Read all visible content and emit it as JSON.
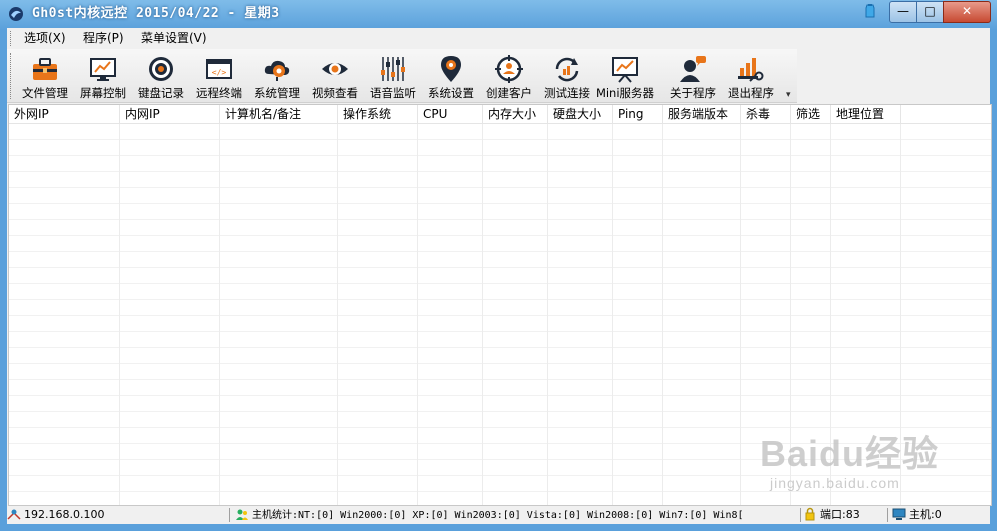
{
  "window": {
    "title": "Gh0st内核远控    2015/04/22 - 星期3",
    "buttons": {
      "minimize": "—",
      "maximize": "□",
      "close": "✕"
    }
  },
  "menubar": {
    "items": [
      {
        "label": "选项(X)"
      },
      {
        "label": "程序(P)"
      },
      {
        "label": "菜单设置(V)"
      }
    ]
  },
  "toolbar": {
    "items": [
      {
        "label": "文件管理",
        "icon": "toolbox-icon"
      },
      {
        "label": "屏幕控制",
        "icon": "monitor-chart-icon"
      },
      {
        "label": "键盘记录",
        "icon": "target-icon"
      },
      {
        "label": "远程终端",
        "icon": "code-window-icon"
      },
      {
        "label": "系统管理",
        "icon": "cloud-gear-icon"
      },
      {
        "label": "视频查看",
        "icon": "eye-icon"
      },
      {
        "label": "语音监听",
        "icon": "equalizer-icon"
      },
      {
        "label": "系统设置",
        "icon": "map-pin-gear-icon"
      },
      {
        "label": "创建客户",
        "icon": "crosshair-user-icon"
      },
      {
        "label": "测试连接",
        "icon": "refresh-chart-icon"
      },
      {
        "label": "Mini服务器",
        "icon": "presentation-icon"
      },
      {
        "label": "关于程序",
        "icon": "user-chat-icon"
      },
      {
        "label": "退出程序",
        "icon": "bar-key-icon"
      }
    ]
  },
  "table": {
    "columns": [
      {
        "label": "外网IP"
      },
      {
        "label": "内网IP"
      },
      {
        "label": "计算机名/备注"
      },
      {
        "label": "操作系统"
      },
      {
        "label": "CPU"
      },
      {
        "label": "内存大小"
      },
      {
        "label": "硬盘大小"
      },
      {
        "label": "Ping"
      },
      {
        "label": "服务端版本"
      },
      {
        "label": "杀毒"
      },
      {
        "label": "筛选"
      },
      {
        "label": "地理位置"
      }
    ],
    "rows": []
  },
  "statusbar": {
    "ip": "192.168.0.100",
    "host_stats": "主机统计:NT:[0]  Win2000:[0]  XP:[0]  Win2003:[0]  Vista:[0]  Win2008:[0]  Win7:[0]  Win8[",
    "port": "端口:83",
    "hosts": "主机:0"
  },
  "watermark": {
    "main": "Baidu经验",
    "sub": "jingyan.baidu.com"
  },
  "colors": {
    "titlebar": "#5aa0db",
    "toolbar_orange": "#e8751a",
    "toolbar_dark": "#1f2a3a"
  }
}
